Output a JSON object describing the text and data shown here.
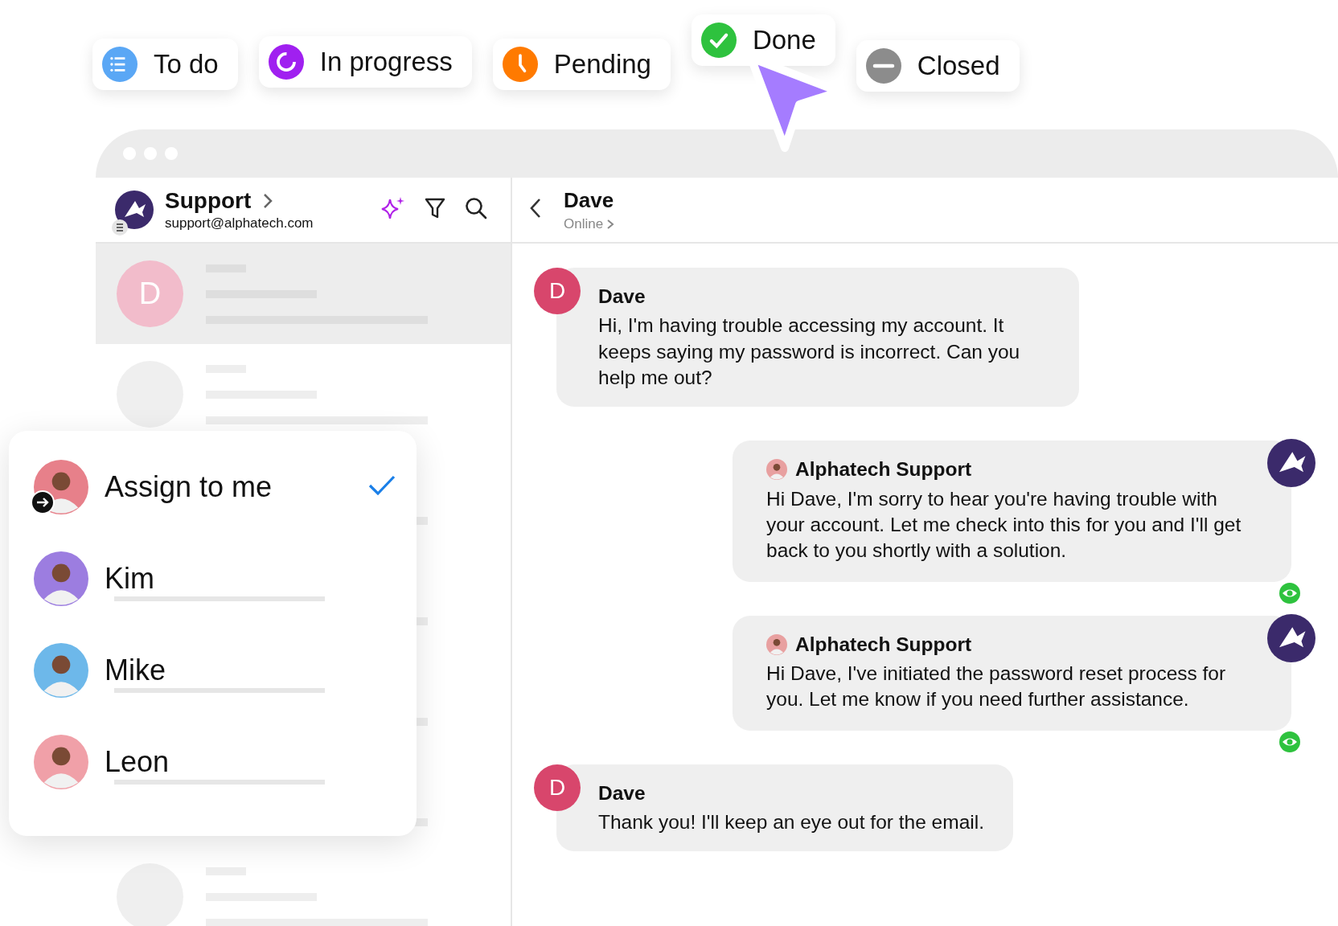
{
  "status_chips": [
    {
      "label": "To do",
      "kind": "todo",
      "color": "#5aa7f5"
    },
    {
      "label": "In progress",
      "kind": "progress",
      "color": "#a020f0"
    },
    {
      "label": "Pending",
      "kind": "pending",
      "color": "#ff7a00"
    },
    {
      "label": "Done",
      "kind": "done",
      "color": "#2ec23e"
    },
    {
      "label": "Closed",
      "kind": "closed",
      "color": "#8c8c8c"
    }
  ],
  "inbox": {
    "name": "Support",
    "email": "support@alphatech.com"
  },
  "conversation_list": [
    {
      "initial": "D",
      "selected": true
    },
    {
      "selected": false
    },
    {
      "selected": false
    },
    {
      "selected": false
    },
    {
      "selected": false
    },
    {
      "selected": false
    },
    {
      "selected": false
    }
  ],
  "chat_header": {
    "name": "Dave",
    "status": "Online"
  },
  "messages": [
    {
      "kind": "customer",
      "initial": "D",
      "sender": "Dave",
      "text": "Hi, I'm having trouble accessing my account. It keeps saying my password is incorrect. Can you help me out?"
    },
    {
      "kind": "agent",
      "sender": "Alphatech Support",
      "text": "Hi Dave, I'm sorry to hear you're having trouble with your account. Let me check into this for you and I'll get back to you shortly with a solution.",
      "seen": true
    },
    {
      "kind": "agent",
      "sender": "Alphatech Support",
      "text": "Hi Dave, I've initiated the password reset process for you. Let me know if you need further assistance.",
      "seen": true
    },
    {
      "kind": "customer",
      "initial": "D",
      "sender": "Dave",
      "text": "Thank you! I'll keep an eye out for the email."
    }
  ],
  "assign_menu": [
    {
      "kind": "self",
      "label": "Assign to me",
      "selected": true
    },
    {
      "kind": "agent",
      "label": "Kim",
      "selected": false
    },
    {
      "kind": "agent",
      "label": "Mike",
      "selected": false
    },
    {
      "kind": "agent",
      "label": "Leon",
      "selected": false
    }
  ]
}
